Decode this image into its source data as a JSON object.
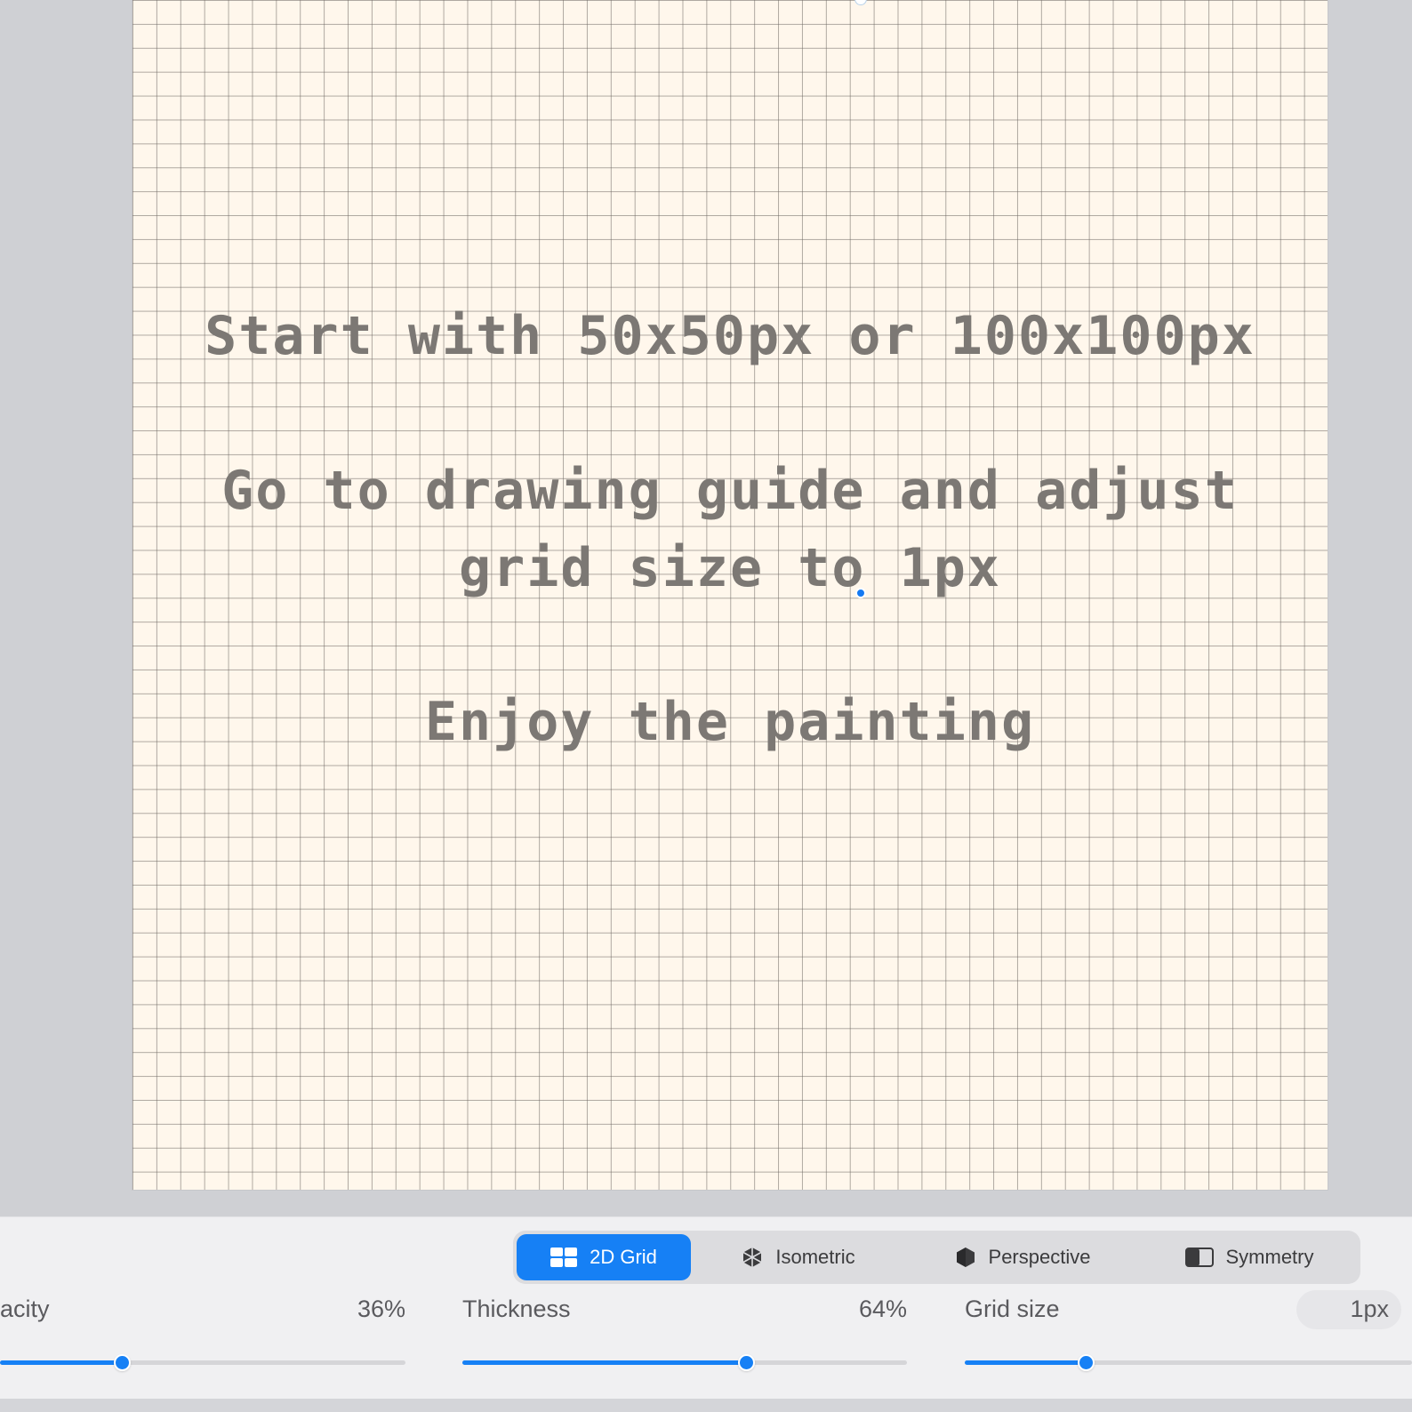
{
  "canvas": {
    "line1": "Start with 50x50px or 100x100px",
    "line2": "Go to drawing guide and adjust",
    "line3": "grid size to 1px",
    "line4": "Enjoy the painting"
  },
  "modes": {
    "grid2d": {
      "label": "2D Grid",
      "icon": "grid-2d-icon",
      "selected": true
    },
    "isometric": {
      "label": "Isometric",
      "icon": "isometric-icon"
    },
    "perspective": {
      "label": "Perspective",
      "icon": "perspective-icon"
    },
    "symmetry": {
      "label": "Symmetry",
      "icon": "symmetry-icon"
    }
  },
  "sliders": {
    "opacity": {
      "label": "acity",
      "value": "36%",
      "fraction": 0.3
    },
    "thickness": {
      "label": "Thickness",
      "value": "64%",
      "fraction": 0.637
    },
    "grid_size": {
      "label": "Grid size",
      "value": "1px",
      "fraction": 0.27
    }
  },
  "colors": {
    "accent": "#1680f5",
    "canvas": "#fff7ec",
    "text": "#7c7874"
  }
}
